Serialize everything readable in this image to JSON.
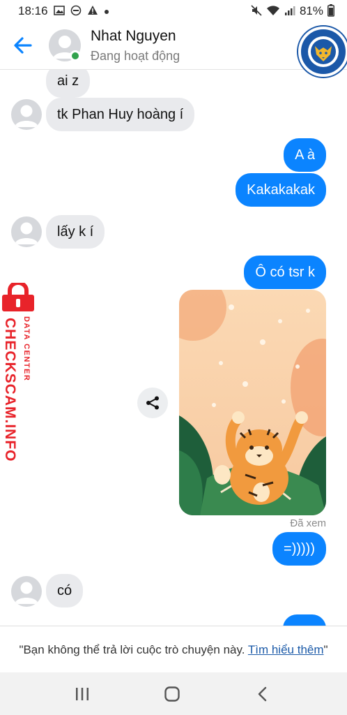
{
  "status_bar": {
    "time": "18:16",
    "battery": "81%",
    "left_icons": [
      "image-icon",
      "do-not-disturb-icon",
      "warning-icon",
      "dot-icon"
    ],
    "right_icons": [
      "mute-icon",
      "wifi-icon",
      "signal-icon",
      "battery-icon"
    ]
  },
  "header": {
    "contact_name": "Nhat Nguyen",
    "presence": "Đang hoạt động",
    "online_color": "#31a24c",
    "logo_text": "LEICESTER CITY FOOTBALL CLUB"
  },
  "messages": [
    {
      "direction": "in",
      "text": "ai z"
    },
    {
      "direction": "in",
      "text": "tk Phan Huy hoàng í"
    },
    {
      "direction": "out",
      "text": "A à"
    },
    {
      "direction": "out",
      "text": "Kakakakak"
    },
    {
      "direction": "in",
      "text": "lấy k í"
    },
    {
      "direction": "out",
      "text": "Ô có tsr k"
    },
    {
      "direction": "out",
      "type": "image"
    },
    {
      "direction": "out",
      "text": "=)))))"
    },
    {
      "direction": "in",
      "text": "có"
    }
  ],
  "seen_label": "Đã xem",
  "watermark": {
    "main": "CHECKSCAM.INFO",
    "sub": "DATA CENTER",
    "color": "#e8232a"
  },
  "footer": {
    "notice": "\"Bạn không thể trả lời cuộc trò chuyện này. ",
    "link": "Tìm hiểu thêm",
    "closing": "\""
  },
  "colors": {
    "outgoing_bubble": "#0b84ff",
    "incoming_bubble": "#e9eaed",
    "accent": "#0b84ff"
  }
}
